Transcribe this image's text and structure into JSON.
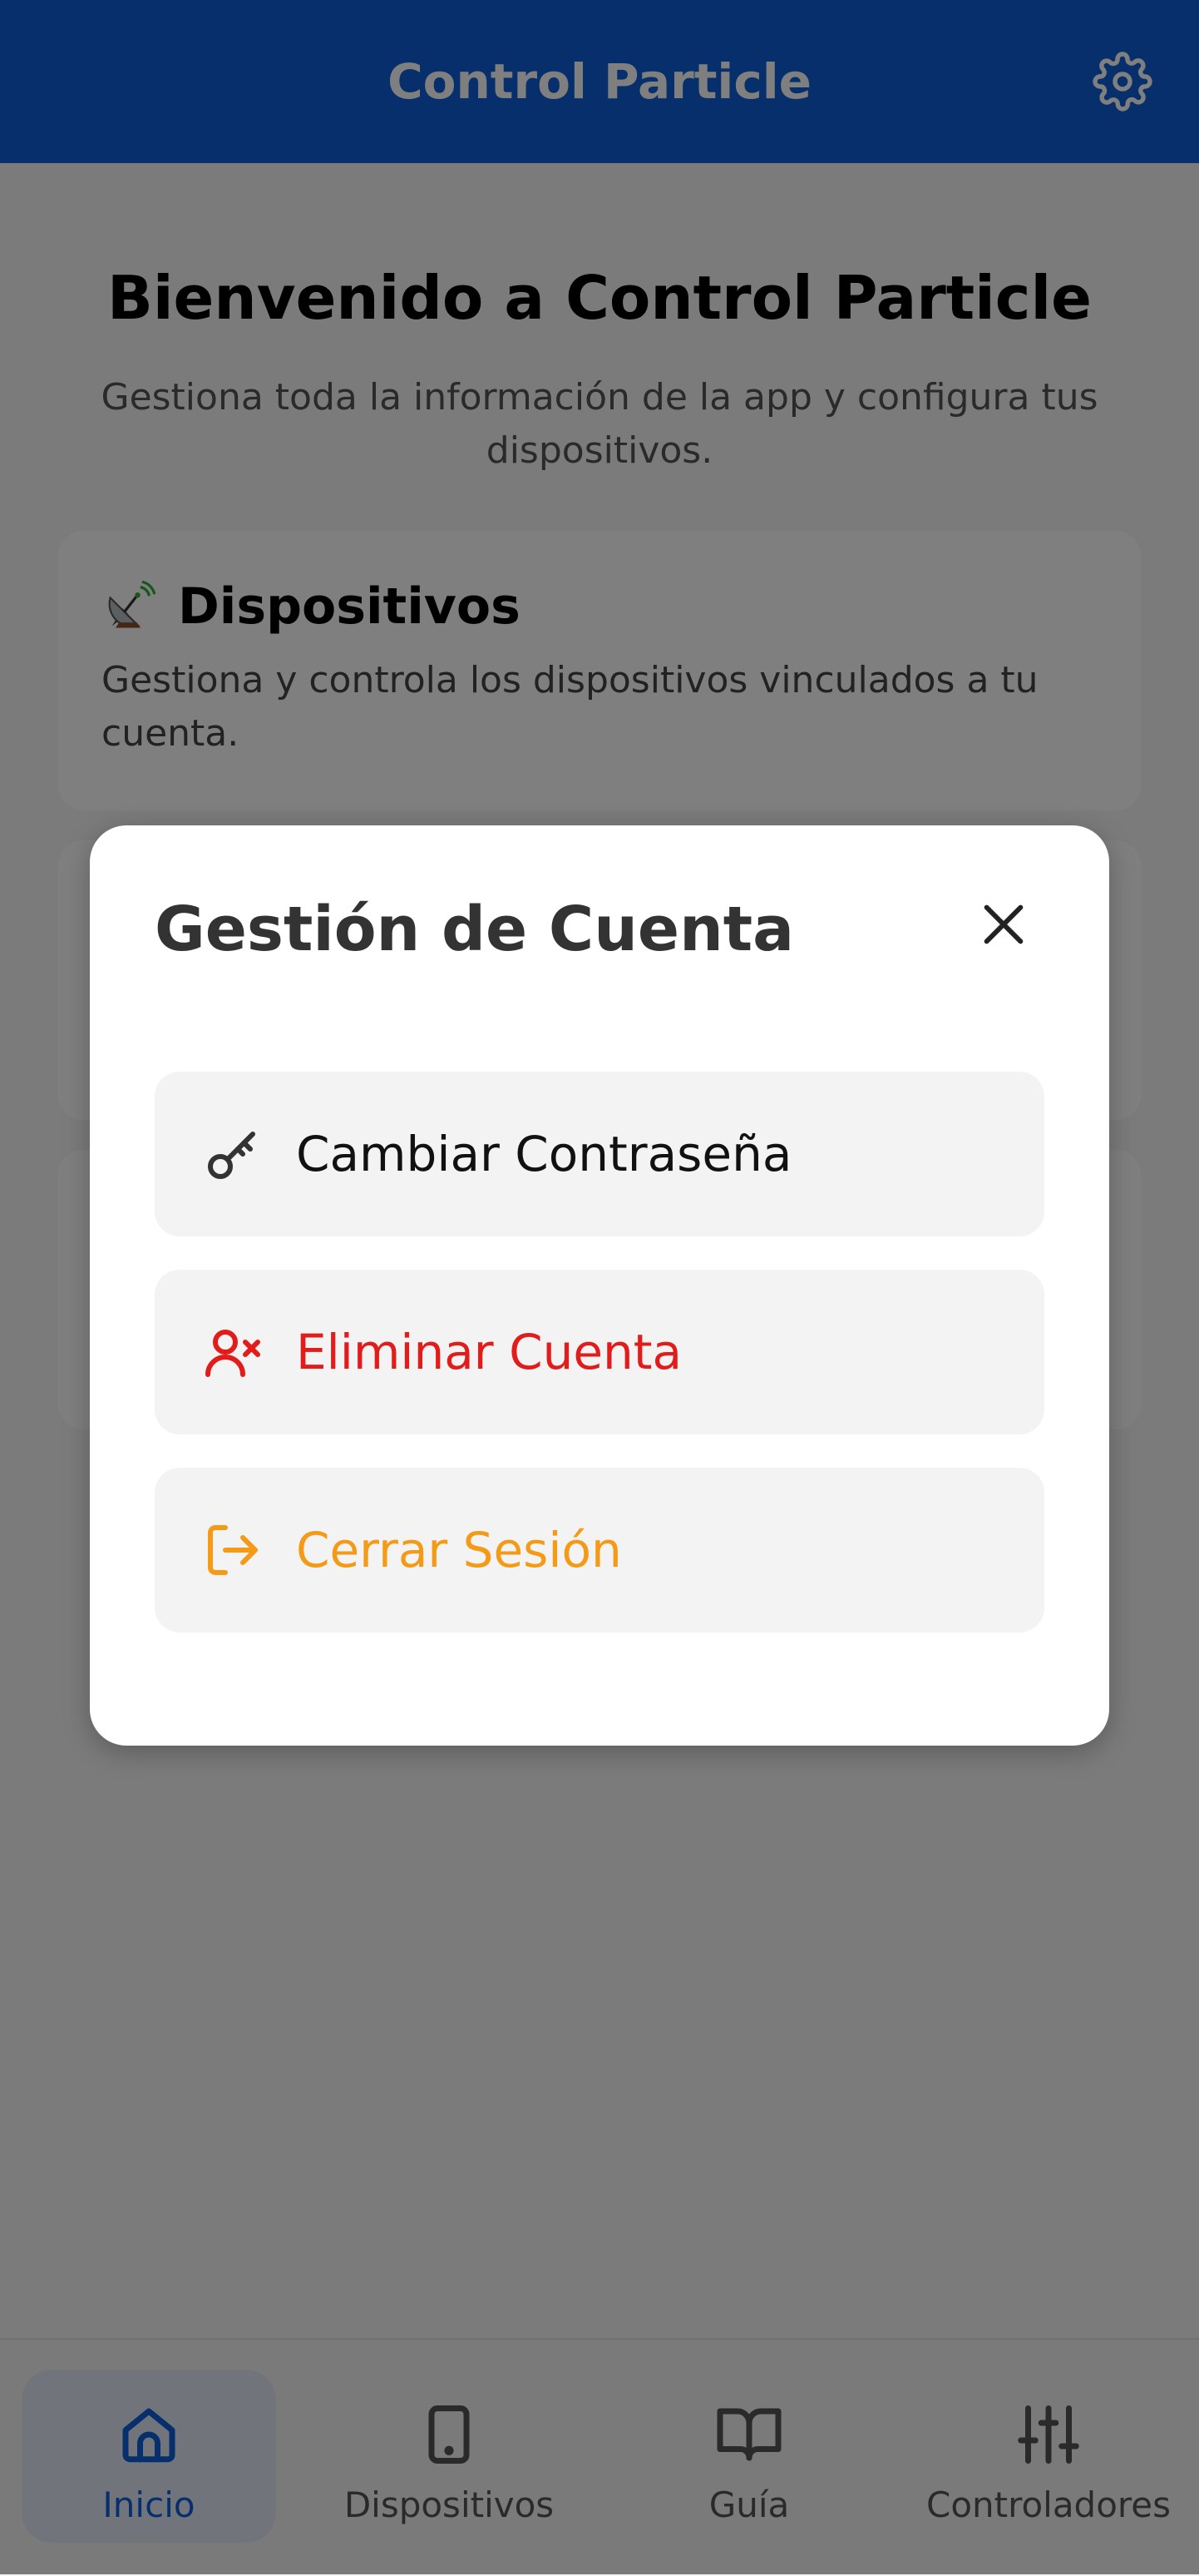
{
  "header": {
    "title": "Control Particle",
    "settings_icon": "gear-icon"
  },
  "welcome": {
    "title": "Bienvenido a Control Particle",
    "subtitle": "Gestiona toda la información de la app y configura tus dispositivos."
  },
  "cards": [
    {
      "icon": "satellite-dish-icon",
      "title": "Dispositivos",
      "description": "Gestiona y controla los dispositivos vinculados a tu cuenta."
    }
  ],
  "modal": {
    "title": "Gestión de Cuenta",
    "close_icon": "close-icon",
    "options": [
      {
        "label": "Cambiar Contraseña",
        "icon": "key-icon",
        "color": "#111111"
      },
      {
        "label": "Eliminar Cuenta",
        "icon": "user-remove-icon",
        "color": "#e21b1b"
      },
      {
        "label": "Cerrar Sesión",
        "icon": "logout-icon",
        "color": "#f59a16"
      }
    ]
  },
  "bottom_nav": {
    "active": "Inicio",
    "items": [
      {
        "label": "Inicio",
        "icon": "home-icon"
      },
      {
        "label": "Dispositivos",
        "icon": "tablet-icon"
      },
      {
        "label": "Guía",
        "icon": "book-icon"
      },
      {
        "label": "Controladores",
        "icon": "sliders-icon"
      }
    ]
  },
  "colors": {
    "primary": "#0d5fd8",
    "danger": "#e21b1b",
    "warning": "#f59a16",
    "overlay": "rgba(0,0,0,0.5)"
  }
}
